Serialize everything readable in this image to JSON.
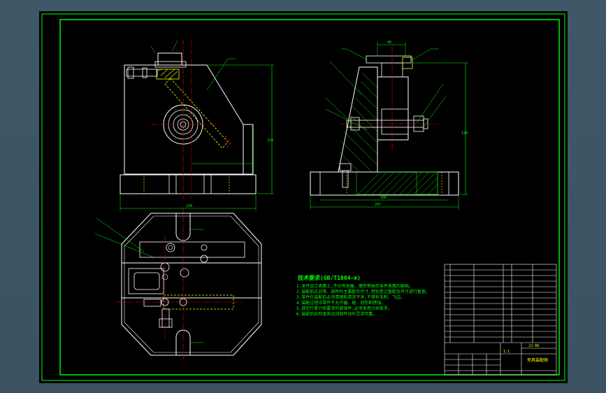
{
  "drawing": {
    "colors": {
      "background": "#000000",
      "frame": "#00ff00",
      "outline": "#ffffff",
      "centerline": "#ff0000",
      "hatch": "#00ff00",
      "hidden": "#ffff00",
      "dimension": "#00ff00",
      "title_block_text": "#ffff00"
    },
    "dimensions": {
      "front_width": "230",
      "front_height": "220",
      "side_width": "100",
      "side_width_total": "207",
      "side_height": "130",
      "top_spacing": "40"
    },
    "technical_notes": {
      "title": "技术要求(GB/T1804-m)",
      "lines": [
        "1.零件加工表面上,不应有划痕、擦伤等损伤零件表面的缺陷。",
        "2.装配前应对零、部件的主要配合尺寸,特别是过盈配合尺寸进行复查。",
        "3.零件在装配前必须清理和清洗干净,不得有毛刺、飞边。",
        "4.装配过程中零件不允许磕、碰、划伤和锈蚀。",
        "5.规定拧紧力矩要求的紧固件,必须采用力矩扳手。",
        "6.装配后应检查各运动部件动作灵活可靠。"
      ]
    },
    "title_block": {
      "drawing_name": "夹具装配图",
      "drawing_number": "JJ-00",
      "scale": "1:1"
    }
  }
}
